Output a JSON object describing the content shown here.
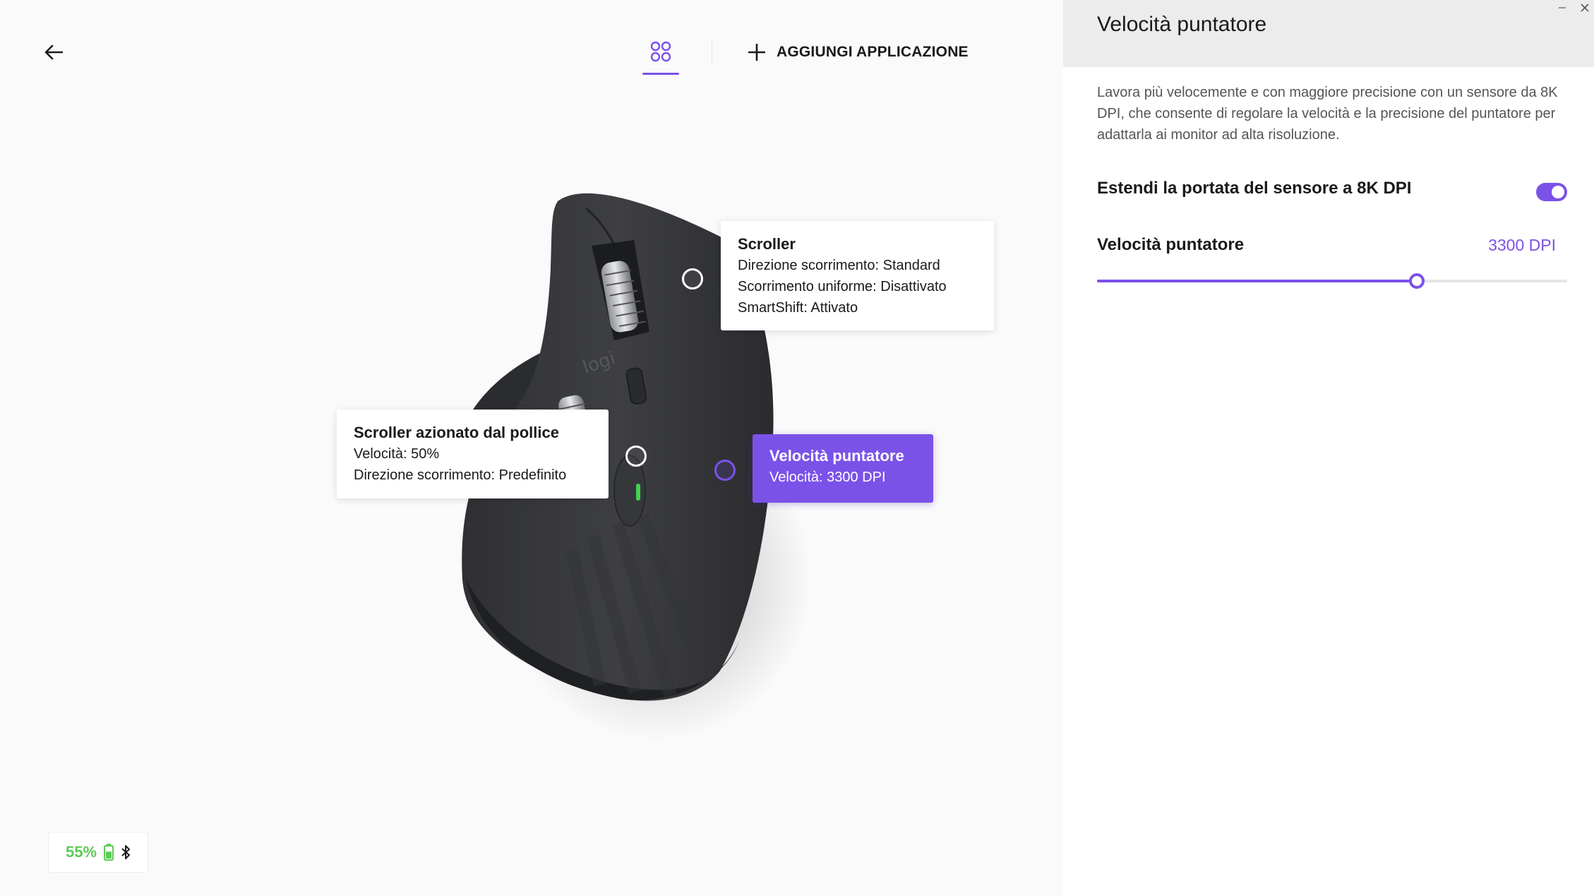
{
  "header": {
    "add_app_label": "AGGIUNGI APPLICAZIONE"
  },
  "callouts": {
    "scroller": {
      "title": "Scroller",
      "lines": [
        "Direzione scorrimento: Standard",
        "Scorrimento uniforme: Disattivato",
        "SmartShift: Attivato"
      ]
    },
    "thumb_scroller": {
      "title": "Scroller azionato dal pollice",
      "lines": [
        "Velocità: 50%",
        "Direzione scorrimento: Predefinito"
      ]
    },
    "pointer_speed": {
      "title": "Velocità puntatore",
      "lines": [
        "Velocità: 3300 DPI"
      ]
    }
  },
  "mouse": {
    "logo_text": "logi"
  },
  "battery": {
    "percent": "55%",
    "level": 0.55
  },
  "panel": {
    "title": "Velocità puntatore",
    "description": "Lavora più velocemente e con maggiore precisione con un sensore da 8K DPI, che consente di regolare la velocità e la precisione del puntatore per adattarla ai monitor ad alta risoluzione.",
    "toggle_label": "Estendi la portata del sensore a 8K DPI",
    "toggle_on": true,
    "speed_label": "Velocità puntatore",
    "speed_value": "3300 DPI",
    "slider_fraction": 0.68
  },
  "colors": {
    "accent": "#7b52e8",
    "battery_green": "#5ccc55"
  }
}
